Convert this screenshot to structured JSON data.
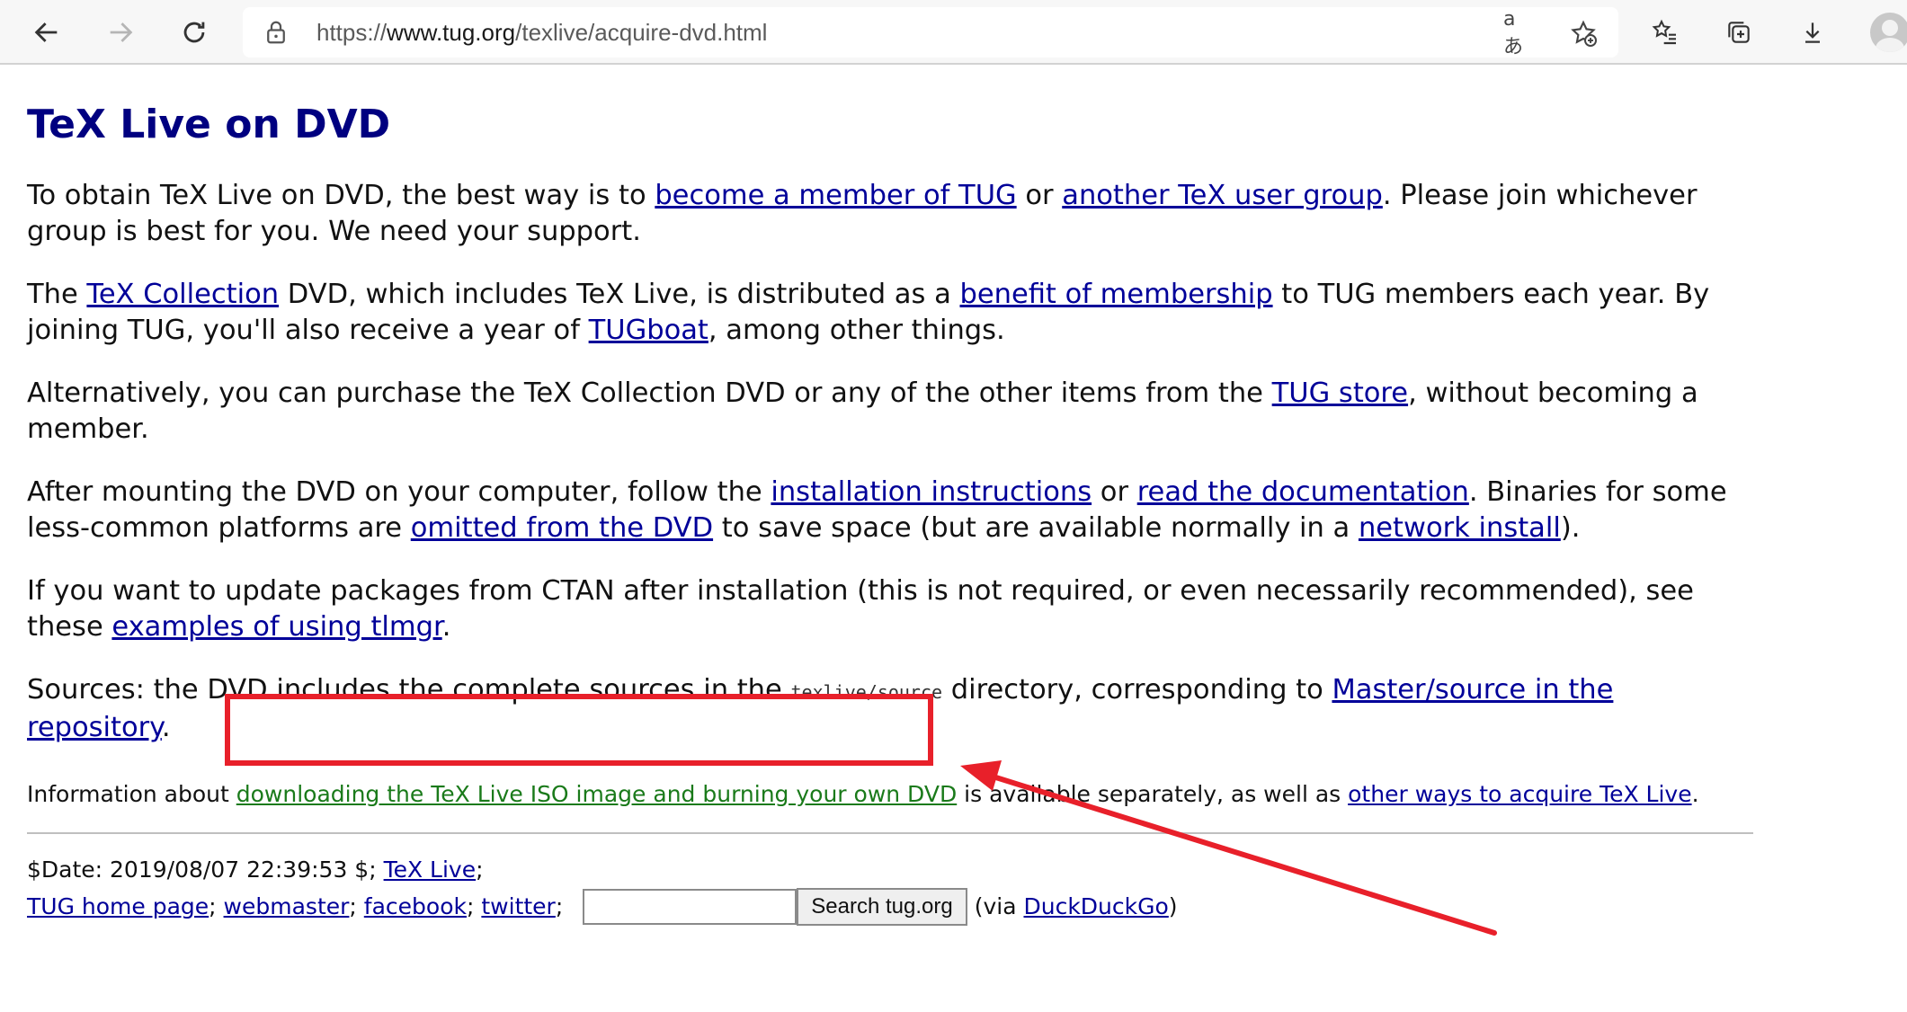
{
  "browser": {
    "url_prefix": "https://",
    "url_host": "www.tug.org",
    "url_path": "/texlive/acquire-dvd.html",
    "translate_label": "aあ"
  },
  "page": {
    "title": "TeX Live on DVD",
    "p1": {
      "t1": "To obtain TeX Live on DVD, the best way is to ",
      "l1": "become a member of TUG",
      "t2": " or ",
      "l2": "another TeX user group",
      "t3": ". Please join whichever group is best for you. We need your support."
    },
    "p2": {
      "t1": "The ",
      "l1": "TeX Collection",
      "t2": " DVD, which includes TeX Live, is distributed as a ",
      "l2": "benefit of membership",
      "t3": " to TUG members each year. By joining TUG, you'll also receive a year of ",
      "l3": "TUGboat",
      "t4": ", among other things."
    },
    "p3": {
      "t1": "Alternatively, you can purchase the TeX Collection DVD or any of the other items from the ",
      "l1": "TUG store",
      "t2": ", without becoming a member."
    },
    "p4": {
      "t1": "After mounting the DVD on your computer, follow the ",
      "l1": "installation instructions",
      "t2": " or ",
      "l2": "read the documentation",
      "t3": ". Binaries for some less-common platforms are ",
      "l3": "omitted from the DVD",
      "t4": " to save space (but are available normally in a ",
      "l4": "network install",
      "t5": ")."
    },
    "p5": {
      "t1": "If you want to update packages from CTAN after installation (this is not required, or even necessarily recommended), see these ",
      "l1": "examples of using tlmgr",
      "t2": "."
    },
    "p6": {
      "t1": "Sources: the DVD includes the complete sources in the ",
      "code": "texlive/source",
      "t2": " directory, corresponding to ",
      "l1": "Master/source in the repository",
      "t3": "."
    },
    "p7": {
      "t1": "Information about ",
      "l1": "downloading the TeX Live ISO image and burning your own DVD",
      "t2": " is available separately, as well as ",
      "l2": "other ways to acquire TeX Live",
      "t3": "."
    },
    "footer": {
      "date": "$Date: 2019/08/07 22:39:53 $; ",
      "l_texlive": "TeX Live",
      "sep": ";",
      "l_home": "TUG home page",
      "l_webmaster": "webmaster",
      "l_facebook": "facebook",
      "l_twitter": "twitter",
      "search_value": "",
      "search_button": "Search tug.org",
      "via_open": "(via ",
      "l_duck": "DuckDuckGo",
      "via_close": ")"
    }
  },
  "colors": {
    "heading": "#000080",
    "link": "#000099",
    "highlighted_link": "#1a7a1a",
    "annotation": "#e8202a"
  }
}
